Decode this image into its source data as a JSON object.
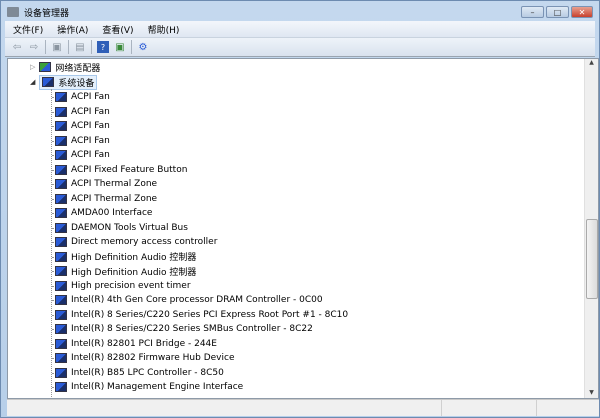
{
  "window": {
    "title": "设备管理器",
    "minimize": "–",
    "maximize": "□",
    "close": "✕"
  },
  "menu": [
    "文件(F)",
    "操作(A)",
    "查看(V)",
    "帮助(H)"
  ],
  "toolbar": [
    "back-icon",
    "forward-icon",
    "properties-icon",
    "refresh-icon",
    "help-icon",
    "scan-icon",
    "update-driver-icon"
  ],
  "tree": {
    "collapsed_category": "网络适配器",
    "expanded_category": "系统设备",
    "devices": [
      "ACPI Fan",
      "ACPI Fan",
      "ACPI Fan",
      "ACPI Fan",
      "ACPI Fan",
      "ACPI Fixed Feature Button",
      "ACPI Thermal Zone",
      "ACPI Thermal Zone",
      "AMDA00 Interface",
      "DAEMON Tools Virtual Bus",
      "Direct memory access controller",
      "High Definition Audio 控制器",
      "High Definition Audio 控制器",
      "High precision event timer",
      "Intel(R) 4th Gen Core processor DRAM Controller - 0C00",
      "Intel(R) 8 Series/C220 Series PCI Express Root Port #1 - 8C10",
      "Intel(R) 8 Series/C220 Series SMBus Controller - 8C22",
      "Intel(R) 82801 PCI Bridge - 244E",
      "Intel(R) 82802 Firmware Hub Device",
      "Intel(R) B85 LPC Controller - 8C50",
      "Intel(R) Management Engine Interface"
    ]
  },
  "scrollbar": {
    "position_fraction": 0.55
  }
}
